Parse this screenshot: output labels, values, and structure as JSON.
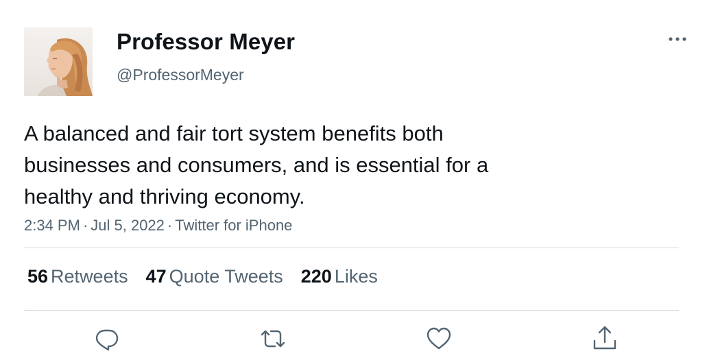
{
  "tweet": {
    "author_name": "Professor Meyer",
    "author_handle": "@ProfessorMeyer",
    "text_lines": [
      "A balanced and fair tort system benefits both",
      "businesses and consumers, and is essential for a",
      "healthy and thriving economy."
    ],
    "time": "2:34 PM",
    "date": "Jul 5, 2022",
    "source": "Twitter for iPhone",
    "separator": "·",
    "more_icon": "ellipsis-icon"
  },
  "stats": {
    "retweets": {
      "count": "56",
      "label": "Retweets"
    },
    "quotes": {
      "count": "47",
      "label": "Quote Tweets"
    },
    "likes": {
      "count": "220",
      "label": "Likes"
    }
  },
  "actions": {
    "reply_icon": "reply-icon",
    "retweet_icon": "retweet-icon",
    "like_icon": "heart-icon",
    "share_icon": "share-icon"
  },
  "colors": {
    "text": "#0f1419",
    "secondary": "#536471",
    "divider": "#cfd9de"
  }
}
